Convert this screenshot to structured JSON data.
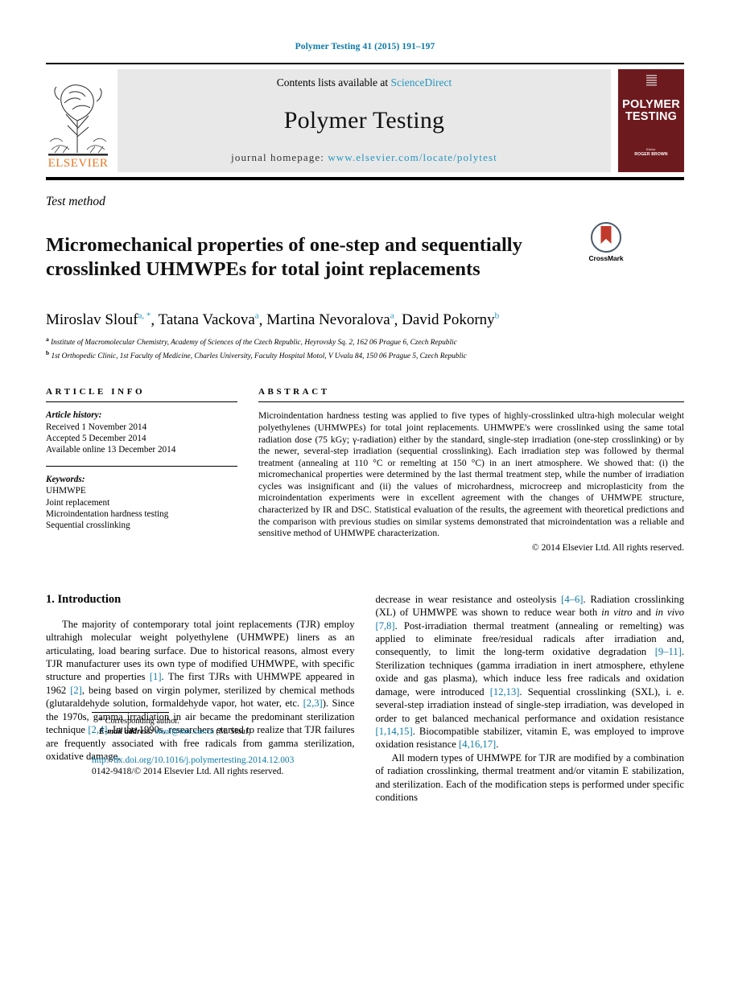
{
  "running_head": "Polymer Testing 41 (2015) 191–197",
  "masthead": {
    "contents_prefix": "Contents lists available at",
    "sciencedirect": "ScienceDirect",
    "journal_name": "Polymer Testing",
    "homepage_label": "journal homepage:",
    "homepage_url": "www.elsevier.com/locate/polytest",
    "publisher_logo_text": "ELSEVIER",
    "cover": {
      "title_line1": "POLYMER",
      "title_line2": "TESTING",
      "editor_label": "Editor",
      "editor_name": "ROGER BROWN"
    }
  },
  "article": {
    "type": "Test method",
    "title": "Micromechanical properties of one-step and sequentially crosslinked UHMWPEs for total joint replacements",
    "crossmark_label": "CrossMark",
    "authors": [
      {
        "name": "Miroslav Slouf",
        "marks": "a, *"
      },
      {
        "name": "Tatana Vackova",
        "marks": "a"
      },
      {
        "name": "Martina Nevoralova",
        "marks": "a"
      },
      {
        "name": "David Pokorny",
        "marks": "b"
      }
    ],
    "affiliations": [
      {
        "mark": "a",
        "text": "Institute of Macromolecular Chemistry, Academy of Sciences of the Czech Republic, Heyrovsky Sq. 2, 162 06 Prague 6, Czech Republic"
      },
      {
        "mark": "b",
        "text": "1st Orthopedic Clinic, 1st Faculty of Medicine, Charles University, Faculty Hospital Motol, V Uvalu 84, 150 06 Prague 5, Czech Republic"
      }
    ]
  },
  "article_info": {
    "heading": "ARTICLE INFO",
    "history_label": "Article history:",
    "history": [
      "Received 1 November 2014",
      "Accepted 5 December 2014",
      "Available online 13 December 2014"
    ],
    "keywords_label": "Keywords:",
    "keywords": [
      "UHMWPE",
      "Joint replacement",
      "Microindentation hardness testing",
      "Sequential crosslinking"
    ]
  },
  "abstract": {
    "heading": "ABSTRACT",
    "text": "Microindentation hardness testing was applied to five types of highly-crosslinked ultra-high molecular weight polyethylenes (UHMWPEs) for total joint replacements. UHMWPE's were crosslinked using the same total radiation dose (75 kGy; γ-radiation) either by the standard, single-step irradiation (one-step crosslinking) or by the newer, several-step irradiation (sequential crosslinking). Each irradiation step was followed by thermal treatment (annealing at 110 °C or remelting at 150 °C) in an inert atmosphere. We showed that: (i) the micromechanical properties were determined by the last thermal treatment step, while the number of irradiation cycles was insignificant and (ii) the values of microhardness, microcreep and microplasticity from the microindentation experiments were in excellent agreement with the changes of UHMWPE structure, characterized by IR and DSC. Statistical evaluation of the results, the agreement with theoretical predictions and the comparison with previous studies on similar systems demonstrated that microindentation was a reliable and sensitive method of UHMWPE characterization.",
    "copyright": "© 2014 Elsevier Ltd. All rights reserved."
  },
  "introduction": {
    "heading": "1. Introduction",
    "left_paragraph_parts": [
      "The majority of contemporary total joint replacements (TJR) employ ultrahigh molecular weight polyethylene (UHMWPE) liners as an articulating, load bearing surface. Due to historical reasons, almost every TJR manufacturer uses its own type of modified UHMWPE, with specific structure and properties ",
      "[1]",
      ". The first TJRs with UHMWPE appeared in 1962 ",
      "[2]",
      ", being based on virgin polymer, sterilized by chemical methods (glutaraldehyde solution, formaldehyde vapor, hot water, etc. ",
      "[2,3]",
      "). Since the 1970s, gamma irradiation in air became the predominant sterilization technique ",
      "[2,4]",
      ". In the 1990s, researchers started to realize that TJR failures are frequently associated with free radicals from gamma sterilization, oxidative damage,"
    ],
    "right_paragraph1_parts": [
      "decrease in wear resistance and osteolysis ",
      "[4–6]",
      ". Radiation crosslinking (XL) of UHMWPE was shown to reduce wear both ",
      "in vitro",
      " and ",
      "in vivo",
      " ",
      "[7,8]",
      ". Post-irradiation thermal treatment (annealing or remelting) was applied to eliminate free/residual radicals after irradiation and, consequently, to limit the long-term oxidative degradation ",
      "[9–11]",
      ". Sterilization techniques (gamma irradiation in inert atmosphere, ethylene oxide and gas plasma), which induce less free radicals and oxidation damage, were introduced ",
      "[12,13]",
      ". Sequential crosslinking (SXL), i. e. several-step irradiation instead of single-step irradiation, was developed in order to get balanced mechanical performance and oxidation resistance ",
      "[1,14,15]",
      ". Biocompatible stabilizer, vitamin E, was employed to improve oxidation resistance ",
      "[4,16,17]",
      "."
    ],
    "right_paragraph2": "All modern types of UHMWPE for TJR are modified by a combination of radiation crosslinking, thermal treatment and/or vitamin E stabilization, and sterilization. Each of the modification steps is performed under specific conditions"
  },
  "footnotes": {
    "corresponding": "Corresponding author.",
    "email_label": "E-mail address:",
    "email": "slouf@imc.cas.cz",
    "email_suffix": "(M. Slouf)"
  },
  "bottom": {
    "doi": "http://dx.doi.org/10.1016/j.polymertesting.2014.12.003",
    "issn": "0142-9418/© 2014 Elsevier Ltd. All rights reserved."
  },
  "colors": {
    "link_blue": "#0b7aa8",
    "sciencedirect_blue": "#2596be",
    "elsevier_orange": "#E87722",
    "cover_maroon": "#6d1a1f"
  }
}
